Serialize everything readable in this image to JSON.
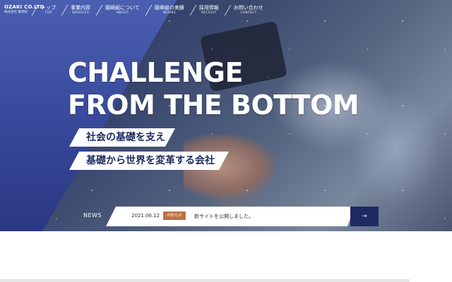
{
  "logo": {
    "name": "OZAKI CO.LTD",
    "subtitle": "株式会社 尾崎組"
  },
  "nav": [
    {
      "jp": "トップ",
      "en": "TOP"
    },
    {
      "jp": "事業内容",
      "en": "SERVICES"
    },
    {
      "jp": "園崎組について",
      "en": "ABOUT"
    },
    {
      "jp": "園崎組の実績",
      "en": "WORKS"
    },
    {
      "jp": "採用情報",
      "en": "RECRUIT"
    },
    {
      "jp": "お問い合わせ",
      "en": "CONTACT"
    }
  ],
  "hero": {
    "headline_line1": "CHALLENGE",
    "headline_line2": "FROM THE BOTTOM",
    "tagline1": "社会の基礎を支え",
    "tagline2": "基礎から世界を変革する会社"
  },
  "news": {
    "label": "NEWS",
    "date": "2021.06.12",
    "badge": "お知らせ",
    "text": "新サイトを公開しました。",
    "arrow": "→"
  },
  "colors": {
    "hero_blue": "#3a4c9e",
    "navy": "#1e2a63",
    "badge": "#c07044"
  }
}
